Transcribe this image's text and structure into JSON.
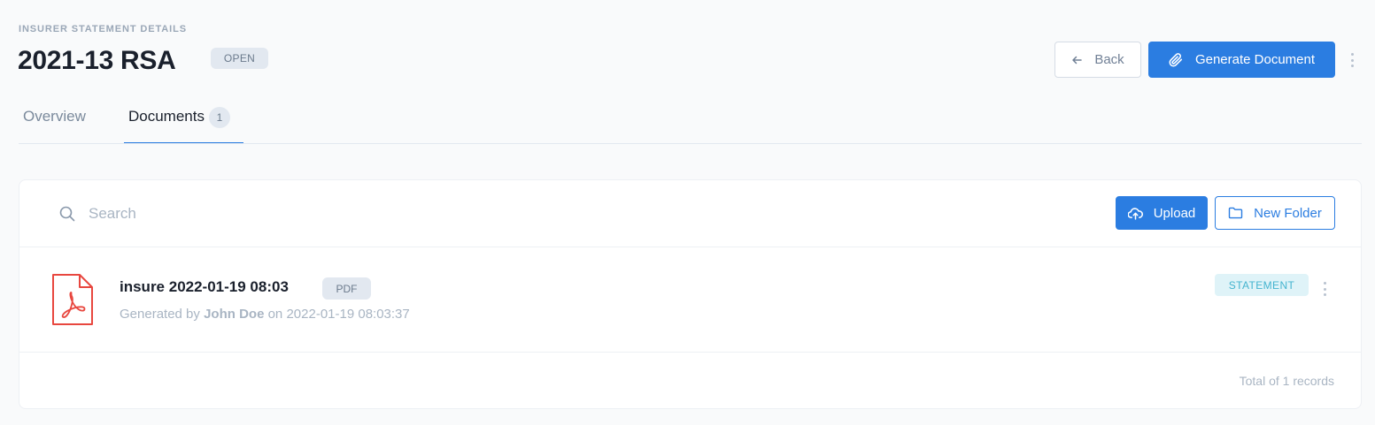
{
  "header": {
    "eyebrow": "INSURER STATEMENT DETAILS",
    "title": "2021-13 RSA",
    "status": "OPEN",
    "back_label": "Back",
    "generate_label": "Generate Document"
  },
  "tabs": [
    {
      "label": "Overview",
      "active": false
    },
    {
      "label": "Documents",
      "active": true,
      "count": "1"
    }
  ],
  "toolbar": {
    "search_placeholder": "Search",
    "upload_label": "Upload",
    "new_folder_label": "New Folder"
  },
  "documents": [
    {
      "name": "insure 2022-01-19 08:03",
      "type": "PDF",
      "meta_prefix": "Generated by",
      "author": "John Doe",
      "meta_on": "on",
      "generated_at": "2022-01-19 08:03:37",
      "category": "STATEMENT",
      "icon": "pdf-file-icon"
    }
  ],
  "footer": {
    "total_text": "Total of 1 records"
  },
  "colors": {
    "primary": "#2b7de1",
    "pdf_red": "#e8473f",
    "category_bg": "#dff3f8",
    "category_text": "#45b4cf"
  }
}
